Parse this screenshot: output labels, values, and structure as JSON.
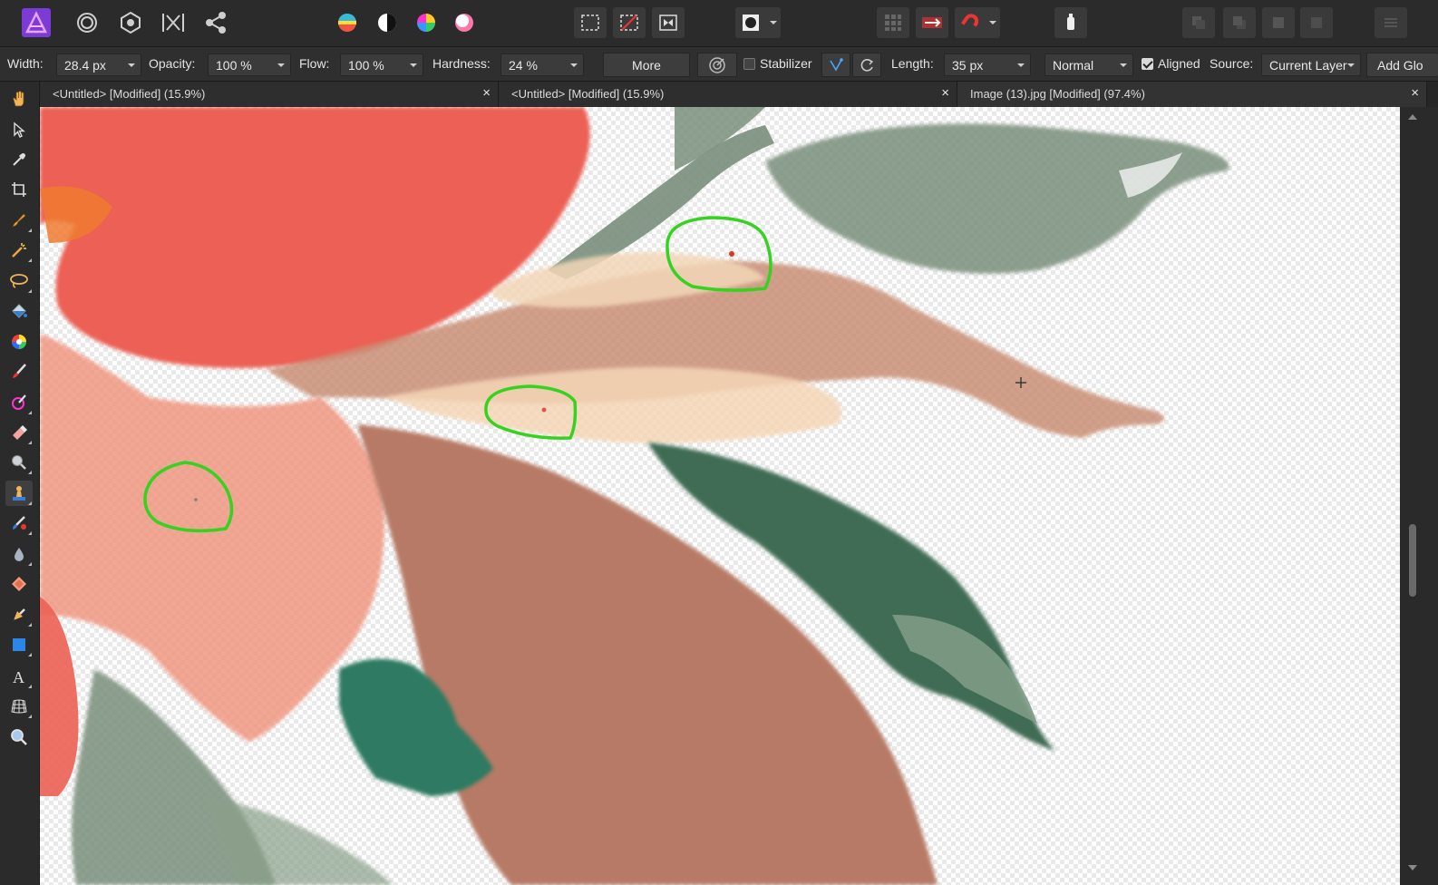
{
  "toolbar": {
    "personas": [
      "app-logo-icon",
      "liquify-persona-icon",
      "develop-persona-icon",
      "tone-mapping-persona-icon",
      "export-persona-icon"
    ],
    "adjustments": [
      "hsl-icon",
      "levels-icon",
      "color-wheel-icon",
      "white-balance-icon"
    ],
    "selection": [
      "marquee-icon",
      "deselect-icon",
      "invert-selection-icon"
    ],
    "quickmask": "quick-mask-icon",
    "snapping": [
      "snapping-grid-icon",
      "force-pixel-alignment-icon",
      "snapping-magnet-icon"
    ],
    "assistant": "assistant-icon",
    "arrange": [
      "move-back-icon",
      "move-forward-icon",
      "move-to-back-icon",
      "move-to-front-icon"
    ],
    "panels": "panels-icon"
  },
  "context": {
    "width_label": "Width:",
    "width_value": "28.4 px",
    "opacity_label": "Opacity:",
    "opacity_value": "100 %",
    "flow_label": "Flow:",
    "flow_value": "100 %",
    "hardness_label": "Hardness:",
    "hardness_value": "24 %",
    "more_label": "More",
    "stabilizer_label": "Stabilizer",
    "stabilizer_checked": false,
    "length_label": "Length:",
    "length_value": "35 px",
    "blend_mode": "Normal",
    "aligned_label": "Aligned",
    "aligned_checked": true,
    "source_label": "Source:",
    "source_value": "Current Layer",
    "add_global_label": "Add Glo"
  },
  "tools": [
    "hand-tool-icon",
    "move-tool-icon",
    "color-picker-tool-icon",
    "crop-tool-icon",
    "selection-brush-tool-icon",
    "flood-select-tool-icon",
    "freehand-selection-tool-icon",
    "flood-fill-tool-icon",
    "gradient-tool-icon",
    "paint-brush-tool-icon",
    "color-replacement-tool-icon",
    "erase-brush-tool-icon",
    "dodge-brush-tool-icon",
    "clone-brush-tool-icon",
    "healing-brush-tool-icon",
    "blur-brush-tool-icon",
    "red-eye-tool-icon",
    "pen-tool-icon",
    "rectangle-tool-icon",
    "artistic-text-tool-icon",
    "mesh-warp-tool-icon",
    "zoom-tool-icon"
  ],
  "tabs": [
    {
      "label": "<Untitled> [Modified] (15.9%)",
      "close": "×"
    },
    {
      "label": "<Untitled> [Modified] (15.9%)",
      "close": "×"
    },
    {
      "label": "Image (13).jpg [Modified] (97.4%)",
      "close": "×"
    }
  ],
  "colors": {
    "annotation": "#35d21f",
    "accent_red": "#e8675a",
    "leaf_green": "#7d917d",
    "dark_green": "#3e6e55",
    "brown": "#b57c69"
  }
}
